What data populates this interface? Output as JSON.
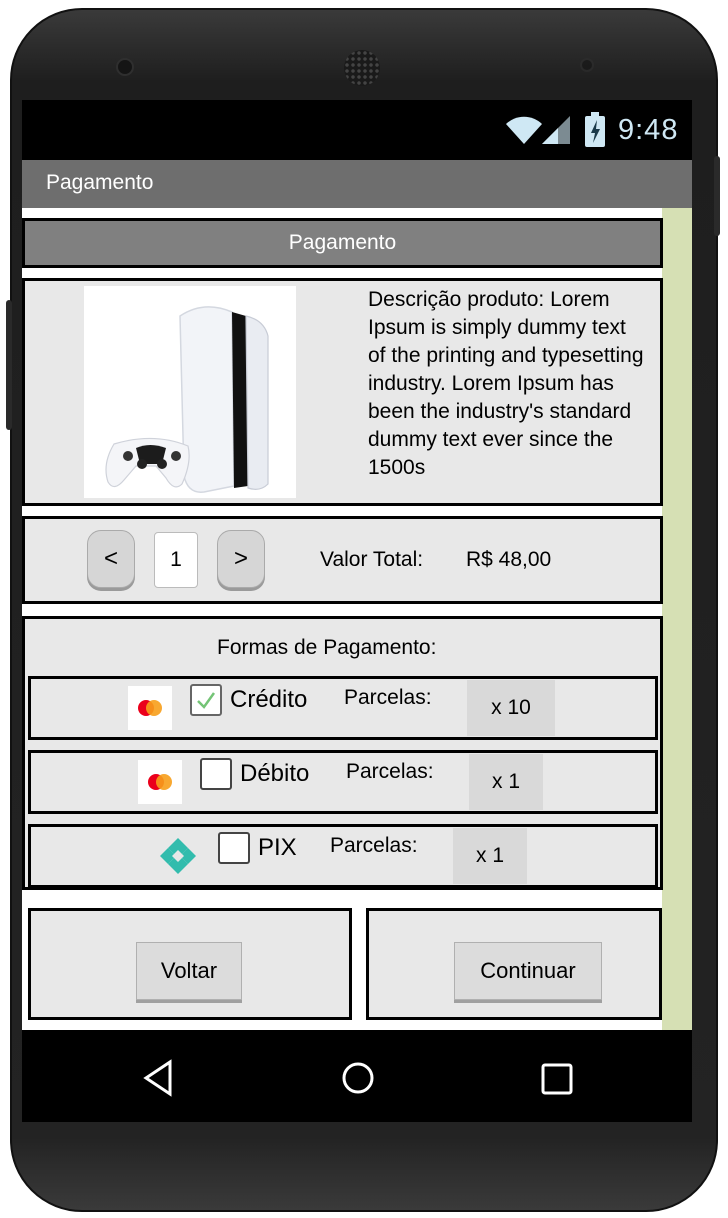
{
  "status_bar": {
    "time": "9:48",
    "wifi_icon": "wifi-icon",
    "signal_icon": "signal-icon",
    "battery_icon": "battery-icon"
  },
  "app_bar": {
    "title": "Pagamento"
  },
  "header": {
    "title": "Pagamento"
  },
  "product": {
    "image_icon": "game-console-image",
    "description": "Descrição produto: Lorem\nIpsum is simply dummy text\nof the printing and typesetting\nindustry. Lorem Ipsum has\nbeen the industry's standard\ndummy text ever since the\n1500s"
  },
  "quantity": {
    "decrement_label": "<",
    "value": "1",
    "increment_label": ">",
    "total_label": "Valor Total:",
    "total_value": "R$ 48,00"
  },
  "payment": {
    "title": "Formas de Pagamento:",
    "methods": [
      {
        "icon": "mastercard-icon",
        "label": "Crédito",
        "checked": true,
        "installments_label": "Parcelas:",
        "installments": "x 10"
      },
      {
        "icon": "mastercard-icon",
        "label": "Débito",
        "checked": false,
        "installments_label": "Parcelas:",
        "installments": "x 1"
      },
      {
        "icon": "pix-icon",
        "label": "PIX",
        "checked": false,
        "installments_label": "Parcelas:",
        "installments": "x 1"
      }
    ]
  },
  "actions": {
    "back_label": "Voltar",
    "continue_label": "Continuar"
  },
  "nav": {
    "back_icon": "back-triangle-icon",
    "home_icon": "home-circle-icon",
    "recents_icon": "recents-square-icon"
  },
  "colors": {
    "title_bar": "#6e6e6e",
    "header": "#808080",
    "panel": "#e8e8e8",
    "accent_strip": "#d6e0b4",
    "status_text": "#cfe8f4"
  }
}
